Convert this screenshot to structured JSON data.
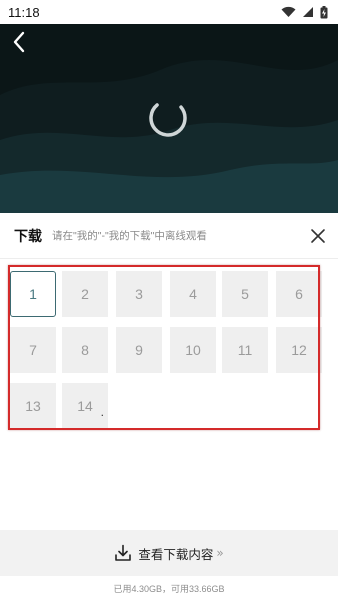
{
  "status_bar": {
    "time": "11:18"
  },
  "panel": {
    "title": "下载",
    "hint": "请在\"我的\"-\"我的下载\"中离线观看"
  },
  "episodes": [
    "1",
    "2",
    "3",
    "4",
    "5",
    "6",
    "7",
    "8",
    "9",
    "10",
    "11",
    "12",
    "13",
    "14"
  ],
  "selected_episode": "1",
  "episode_14_suffix": ".",
  "view_downloads": {
    "label": "查看下载内容",
    "chevron": "»"
  },
  "storage_text": "已用4.30GB，可用33.66GB",
  "colors": {
    "selection_border": "#3d6a72",
    "annotation_box": "#d42a2a",
    "tile_bg": "#efefef"
  },
  "icons": [
    "back-arrow-icon",
    "wifi-icon",
    "cellular-signal-icon",
    "battery-icon",
    "loading-spinner-icon",
    "close-icon",
    "download-icon",
    "double-chevron-icon"
  ]
}
